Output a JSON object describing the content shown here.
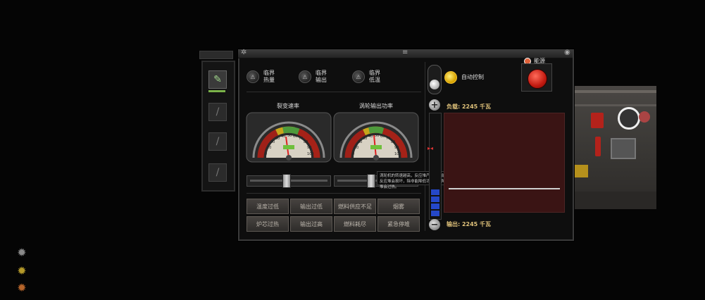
{
  "panel": {
    "warnings": [
      {
        "label": "临界\n热量",
        "icon": "warning-lamp-icon",
        "active": false
      },
      {
        "label": "临界\n输出",
        "icon": "warning-lamp-icon",
        "active": false
      },
      {
        "label": "临界\n低温",
        "icon": "warning-lamp-icon",
        "active": false
      }
    ],
    "auto_control_label": "自动控制",
    "power_label": "能源",
    "gauges": [
      {
        "title": "裂变速率",
        "ticks": [
          "0",
          "10",
          "20",
          "30",
          "40",
          "50",
          "60",
          "70",
          "80",
          "90",
          "100"
        ]
      },
      {
        "title": "涡轮输出功率",
        "ticks": [
          "0",
          "10",
          "20",
          "30",
          "40",
          "50",
          "60",
          "70",
          "80",
          "90",
          "100"
        ]
      }
    ],
    "load_text": "负载: 2245 千瓦",
    "output_text": "输出: 2245 千瓦",
    "tooltip": "涡轮机的转速越高，反应堆产生的电能越多。如果输出功率高于额定功率，反应堆会损坏，除非能降低功率。请降低输出功率直至达到额定功率，反应堆会过热。",
    "buttons": [
      "温度过低",
      "输出过低",
      "燃料供应不足",
      "烟雾",
      "炉芯过热",
      "输出过高",
      "燃料耗尽",
      "紧急停堆"
    ]
  },
  "colors": {
    "accent_yellow": "#e0c27a",
    "power_red": "#c21a10",
    "graph_bg": "#3a1414",
    "meter_blue": "#2548c9"
  }
}
